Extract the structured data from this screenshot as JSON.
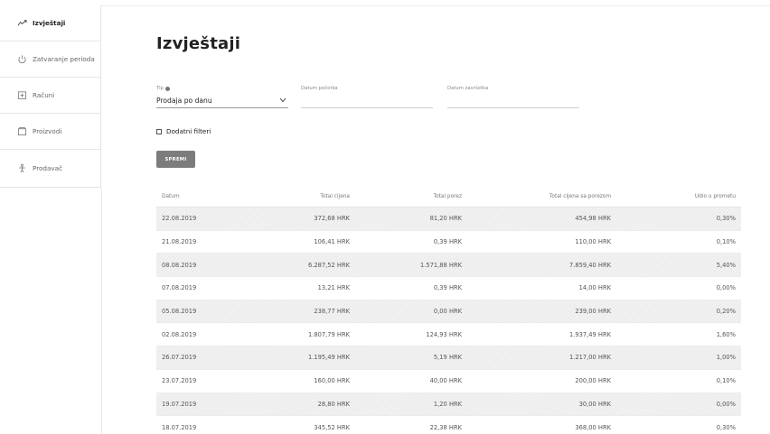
{
  "sidebar": {
    "items": [
      {
        "label": "Izvještaji",
        "icon": "trending-up-icon"
      },
      {
        "label": "Zatvaranje perioda",
        "icon": "power-icon"
      },
      {
        "label": "Računi",
        "icon": "receipt-icon"
      },
      {
        "label": "Proizvodi",
        "icon": "box-icon"
      },
      {
        "label": "Prodavač",
        "icon": "person-icon"
      }
    ]
  },
  "page": {
    "title": "Izvještaji"
  },
  "filters": {
    "tip_label": "Tip",
    "tip_value": "Prodaja po danu",
    "start_label": "Datum početka",
    "start_value": "",
    "end_label": "Datum završetka",
    "end_value": "",
    "additional_label": "Dodatni filteri",
    "save_label": "SPREMI"
  },
  "table": {
    "headers": [
      "Datum",
      "Total cijena",
      "Total porez",
      "Total cijena sa porezom",
      "Udio u prometu"
    ],
    "rows": [
      [
        "22.08.2019",
        "372,68 HRK",
        "81,20 HRK",
        "454,98 HRK",
        "0,30%"
      ],
      [
        "21.08.2019",
        "106,41 HRK",
        "0,39 HRK",
        "110,00 HRK",
        "0,10%"
      ],
      [
        "08.08.2019",
        "6.287,52 HRK",
        "1.571,88 HRK",
        "7.859,40 HRK",
        "5,40%"
      ],
      [
        "07.08.2019",
        "13,21 HRK",
        "0,39 HRK",
        "14,00 HRK",
        "0,00%"
      ],
      [
        "05.08.2019",
        "238,77 HRK",
        "0,00 HRK",
        "239,00 HRK",
        "0,20%"
      ],
      [
        "02.08.2019",
        "1.807,79 HRK",
        "124,93 HRK",
        "1.937,49 HRK",
        "1,60%"
      ],
      [
        "26.07.2019",
        "1.195,49 HRK",
        "5,19 HRK",
        "1.217,00 HRK",
        "1,00%"
      ],
      [
        "23.07.2019",
        "160,00 HRK",
        "40,00 HRK",
        "200,00 HRK",
        "0,10%"
      ],
      [
        "19.07.2019",
        "28,80 HRK",
        "1,20 HRK",
        "30,00 HRK",
        "0,00%"
      ],
      [
        "18.07.2019",
        "345,52 HRK",
        "22,38 HRK",
        "368,00 HRK",
        "0,30%"
      ]
    ]
  },
  "colors": {
    "button_bg": "#7c7c7c",
    "row_alt": "#f2f2f2"
  }
}
